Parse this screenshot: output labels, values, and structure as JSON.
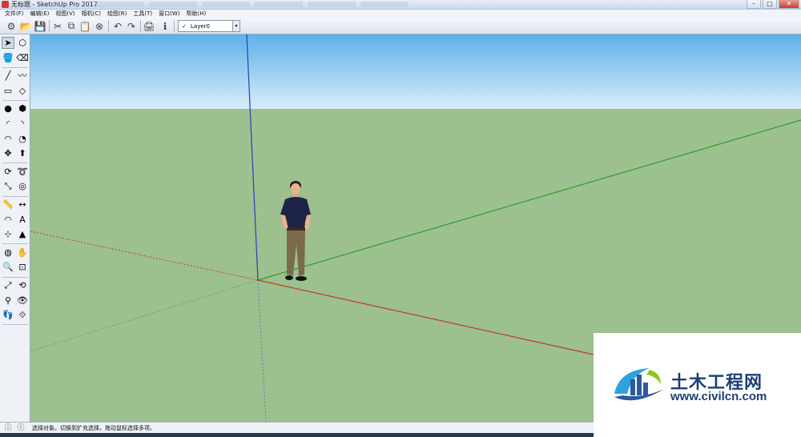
{
  "window": {
    "title": "无标题 - SketchUp Pro 2017",
    "controls": [
      "–",
      "□",
      "✕"
    ]
  },
  "menu": [
    "文件(F)",
    "编辑(E)",
    "视图(V)",
    "相机(C)",
    "绘图(R)",
    "工具(T)",
    "窗口(W)",
    "帮助(H)"
  ],
  "toolbar": {
    "buttons": [
      {
        "name": "getting-started-icon",
        "glyph": "⚙"
      },
      {
        "name": "open-icon",
        "glyph": "📂"
      },
      {
        "name": "save-icon",
        "glyph": "💾"
      },
      {
        "name": "cut-icon",
        "glyph": "✂"
      },
      {
        "name": "copy-icon",
        "glyph": "⧉"
      },
      {
        "name": "paste-icon",
        "glyph": "📋"
      },
      {
        "name": "erase-icon",
        "glyph": "⊗"
      },
      {
        "name": "undo-icon",
        "glyph": "↶"
      },
      {
        "name": "redo-icon",
        "glyph": "↷"
      },
      {
        "name": "print-icon",
        "glyph": "🖨"
      },
      {
        "name": "model-info-icon",
        "glyph": "ℹ"
      }
    ],
    "layer": {
      "check": "✓",
      "value": "Layer0",
      "arrow": "▾"
    }
  },
  "left_tools": [
    {
      "name": "select-icon",
      "glyph": "➤",
      "active": true
    },
    {
      "name": "make-component-icon",
      "glyph": "⬡"
    },
    {
      "name": "paint-bucket-icon",
      "glyph": "🪣"
    },
    {
      "name": "eraser-icon",
      "glyph": "⌫"
    },
    {
      "name": "line-icon",
      "glyph": "╱"
    },
    {
      "name": "freehand-icon",
      "glyph": "〰"
    },
    {
      "name": "rectangle-icon",
      "glyph": "▭"
    },
    {
      "name": "rotated-rectangle-icon",
      "glyph": "◇"
    },
    {
      "name": "circle-icon",
      "glyph": "●"
    },
    {
      "name": "polygon-icon",
      "glyph": "⬢"
    },
    {
      "name": "arc-icon",
      "glyph": "◜"
    },
    {
      "name": "two-point-arc-icon",
      "glyph": "◝"
    },
    {
      "name": "three-point-arc-icon",
      "glyph": "◠"
    },
    {
      "name": "pie-icon",
      "glyph": "◔"
    },
    {
      "name": "move-icon",
      "glyph": "✥"
    },
    {
      "name": "push-pull-icon",
      "glyph": "⬆"
    },
    {
      "name": "rotate-icon",
      "glyph": "⟳"
    },
    {
      "name": "follow-me-icon",
      "glyph": "➰"
    },
    {
      "name": "scale-icon",
      "glyph": "⤡"
    },
    {
      "name": "offset-icon",
      "glyph": "◎"
    },
    {
      "name": "tape-measure-icon",
      "glyph": "📏"
    },
    {
      "name": "dimension-icon",
      "glyph": "↔"
    },
    {
      "name": "protractor-icon",
      "glyph": "◠"
    },
    {
      "name": "text-icon",
      "glyph": "A"
    },
    {
      "name": "axes-icon",
      "glyph": "⊹"
    },
    {
      "name": "3d-text-icon",
      "glyph": "▲"
    },
    {
      "name": "orbit-icon",
      "glyph": "◍"
    },
    {
      "name": "pan-icon",
      "glyph": "✋"
    },
    {
      "name": "zoom-icon",
      "glyph": "🔍"
    },
    {
      "name": "zoom-window-icon",
      "glyph": "⊡"
    },
    {
      "name": "zoom-extents-icon",
      "glyph": "⤢"
    },
    {
      "name": "previous-view-icon",
      "glyph": "⟲"
    },
    {
      "name": "position-camera-icon",
      "glyph": "⚲"
    },
    {
      "name": "look-around-icon",
      "glyph": "👁"
    },
    {
      "name": "walk-icon",
      "glyph": "👣"
    },
    {
      "name": "section-plane-icon",
      "glyph": "⟐"
    }
  ],
  "status": {
    "icons": [
      "ⓘ",
      "ⓘ"
    ],
    "text": "选择对象。切换到扩充选择。拖动鼠标选择多项。"
  },
  "watermark": {
    "name": "土木工程网",
    "url": "www.civilcn.com"
  },
  "colors": {
    "sky_top": "#5cb1e9",
    "ground": "#9cc08e",
    "axis_red": "#c0392b",
    "axis_green": "#2f9e2f",
    "axis_blue": "#2b3fb0",
    "watermark_blue": "#1d3f77"
  }
}
